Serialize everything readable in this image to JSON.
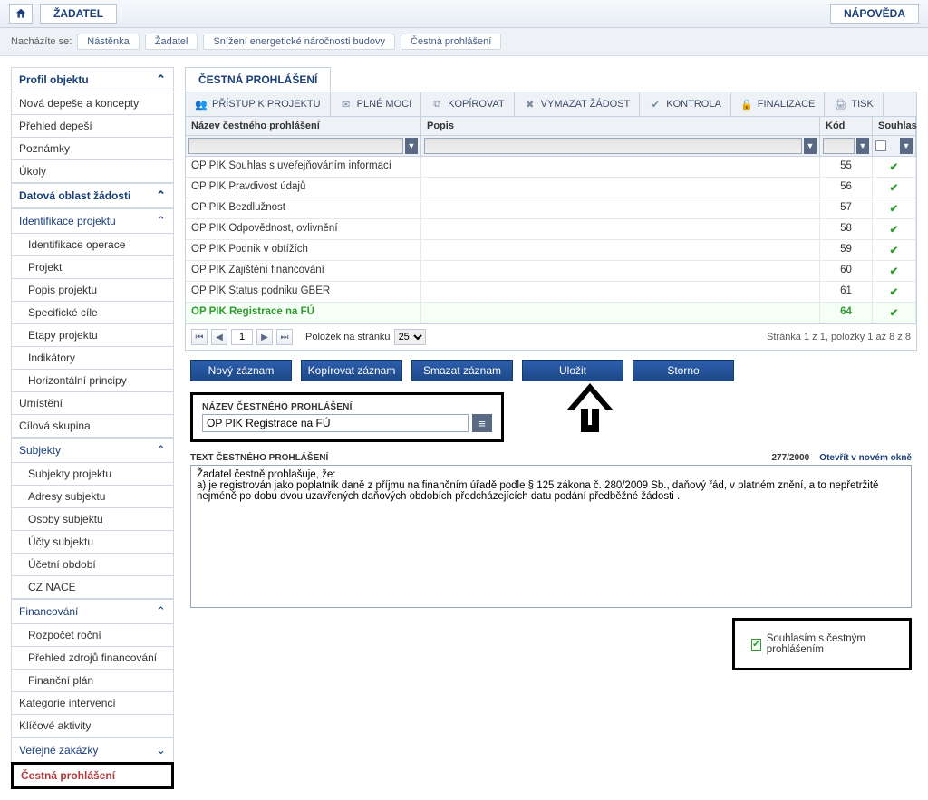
{
  "topbar": {
    "zadatel": "ŽADATEL",
    "napoveda": "NÁPOVĚDA"
  },
  "breadcrumb": {
    "here_label": "Nacházíte se:",
    "items": [
      "Nástěnka",
      "Žadatel",
      "Snížení energetické náročnosti budovy",
      "Čestná prohlášení"
    ]
  },
  "sidebar": {
    "profil": "Profil objektu",
    "nova_depese": "Nová depeše a koncepty",
    "prehled_depesi": "Přehled depeší",
    "poznamky": "Poznámky",
    "ukoly": "Úkoly",
    "datova_oblast": "Datová oblast žádosti",
    "identifikace_projektu": "Identifikace projektu",
    "identifikace_operace": "Identifikace operace",
    "projekt": "Projekt",
    "popis_projektu": "Popis projektu",
    "specificke_cile": "Specifické cíle",
    "etapy": "Etapy projektu",
    "indikatory": "Indikátory",
    "horizontalni": "Horizontální principy",
    "umisteni": "Umístění",
    "cilova": "Cílová skupina",
    "subjekty": "Subjekty",
    "subjekty_projektu": "Subjekty projektu",
    "adresy": "Adresy subjektu",
    "osoby": "Osoby subjektu",
    "ucty": "Účty subjektu",
    "ucetni": "Účetní období",
    "cznace": "CZ NACE",
    "financovani": "Financování",
    "rozpocet": "Rozpočet roční",
    "prehled_zdroju": "Přehled zdrojů financování",
    "financni_plan": "Finanční plán",
    "kategorie": "Kategorie intervencí",
    "klicove": "Klíčové aktivity",
    "verejne": "Veřejné zakázky",
    "cestna": "Čestná prohlášení"
  },
  "content": {
    "tab": "ČESTNÁ PROHLÁŠENÍ",
    "toolbar": {
      "pristup": "PŘÍSTUP K PROJEKTU",
      "plne_moci": "PLNÉ MOCI",
      "kopirovat": "KOPÍROVAT",
      "vymazat": "VYMAZAT ŽÁDOST",
      "kontrola": "KONTROLA",
      "finalizace": "FINALIZACE",
      "tisk": "TISK"
    },
    "grid": {
      "col_nazev": "Název čestného prohlášení",
      "col_popis": "Popis",
      "col_kod": "Kód",
      "col_souhlas": "Souhlas",
      "rows": [
        {
          "nazev": "OP PIK Souhlas s uveřejňováním informací",
          "popis": "",
          "kod": "55"
        },
        {
          "nazev": "OP PIK Pravdivost údajů",
          "popis": "",
          "kod": "56"
        },
        {
          "nazev": "OP PIK Bezdlužnost",
          "popis": "",
          "kod": "57"
        },
        {
          "nazev": "OP PIK Odpovědnost, ovlivnění",
          "popis": "",
          "kod": "58"
        },
        {
          "nazev": "OP PIK Podnik v obtížích",
          "popis": "",
          "kod": "59"
        },
        {
          "nazev": "OP PIK Zajištění financování",
          "popis": "",
          "kod": "60"
        },
        {
          "nazev": "OP PIK Status podniku GBER",
          "popis": "",
          "kod": "61"
        },
        {
          "nazev": "OP PIK Registrace na FÚ",
          "popis": "",
          "kod": "64"
        }
      ]
    },
    "pager": {
      "page": "1",
      "per_page_label": "Položek na stránku",
      "per_page": "25",
      "summary": "Stránka 1 z 1, položky 1 až 8 z 8"
    },
    "actions": {
      "novy": "Nový záznam",
      "kopirovat": "Kopírovat záznam",
      "smazat": "Smazat záznam",
      "ulozit": "Uložit",
      "storno": "Storno"
    },
    "form": {
      "nazev_label": "NÁZEV ČESTNÉHO PROHLÁŠENÍ",
      "nazev_value": "OP PIK Registrace na FÚ",
      "text_label": "TEXT ČESTNÉHO PROHLÁŠENÍ",
      "counter": "277/2000",
      "open_new": "Otevřít v novém okně",
      "text_value": "Žadatel čestně prohlašuje, že:\na) je registrován jako poplatník daně z příjmu na finančním úřadě podle § 125 zákona č. 280/2009 Sb., daňový řád, v platném znění, a to nepřetržitě nejméně po dobu dvou uzavřených daňových obdobích předcházejících datu podání předběžné žádosti .",
      "consent": "Souhlasím s čestným prohlášením"
    }
  }
}
